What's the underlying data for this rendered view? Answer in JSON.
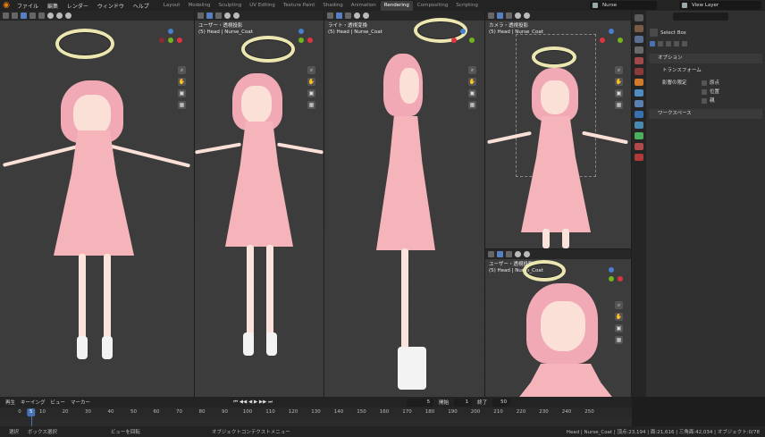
{
  "topbar": {
    "menus": [
      "ファイル",
      "編集",
      "レンダー",
      "ウィンドウ",
      "ヘルプ"
    ],
    "workspace_tabs": [
      "Layout",
      "Modeling",
      "Sculpting",
      "UV Editing",
      "Texture Paint",
      "Shading",
      "Animation",
      "Rendering",
      "Compositing",
      "Scripting"
    ],
    "active_tab": "Rendering",
    "scene_name": "Nurse",
    "view_layer": "View Layer"
  },
  "viewports": [
    {
      "label_line1": "",
      "label_line2": ""
    },
    {
      "label_line1": "ユーザー・透視投影",
      "label_line2": "(5) Head | Nurse_Coat"
    },
    {
      "label_line1": "ライト・透視変換",
      "label_line2": "(5) Head | Nurse_Coat"
    },
    {
      "label_line1": "カメラ・透視投影",
      "label_line2": "(5) Head | Nurse_Coat"
    },
    {
      "label_line1": "ユーザー・透視投影",
      "label_line2": "(5) Head | Nurse_Coat"
    }
  ],
  "properties": {
    "tool_name": "Select Box",
    "options_header": "オプション",
    "transform_header": "トランスフォーム",
    "affect_only_label": "影響の限定",
    "checkboxes": [
      "原点",
      "位置",
      "親"
    ],
    "workspace_header": "ワークスペース"
  },
  "timeline": {
    "menus": [
      "再生",
      "キーイング",
      "ビュー",
      "マーカー"
    ],
    "current_frame": "5",
    "start_label": "開始",
    "start_value": "1",
    "end_label": "終了",
    "end_value": "50",
    "frame_field": "5",
    "ticks": [
      "0",
      "10",
      "20",
      "30",
      "40",
      "50",
      "60",
      "70",
      "80",
      "90",
      "100",
      "110",
      "120",
      "130",
      "140",
      "150",
      "160",
      "170",
      "180",
      "190",
      "200",
      "210",
      "220",
      "230",
      "240",
      "250"
    ]
  },
  "status": {
    "select": "選択",
    "box_select": "ボックス選択",
    "rotate_view": "ビューを回転",
    "context_menu": "オブジェクトコンテクストメニュー",
    "stats": "Head | Nurse_Coat | 頂点:23,194 | 面:21,616 | 三角面:42,034 | オブジェクト:0/78"
  },
  "colors": {
    "accent": "#4772b3",
    "viewport_bg": "#3c3c3c",
    "halo": "#ece6b0",
    "dress": "#f5b4b9",
    "hair": "#f1a9b6"
  }
}
